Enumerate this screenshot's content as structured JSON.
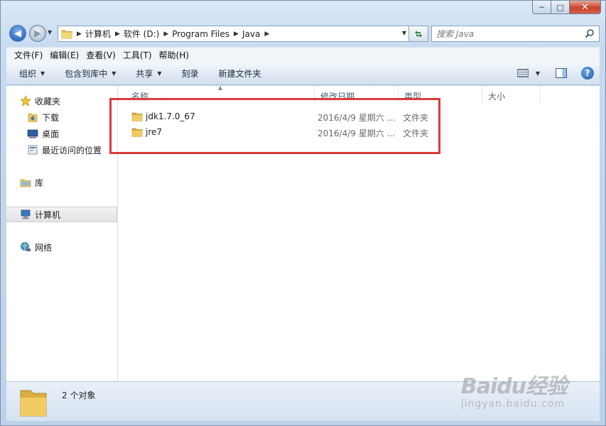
{
  "window": {
    "caption_min": "─",
    "caption_max": "□",
    "caption_close": "✕"
  },
  "address": {
    "crumbs": [
      "计算机",
      "软件 (D:)",
      "Program Files",
      "Java"
    ]
  },
  "search": {
    "placeholder": "搜索 Java"
  },
  "menu": [
    "文件(F)",
    "编辑(E)",
    "查看(V)",
    "工具(T)",
    "帮助(H)"
  ],
  "commands": [
    {
      "label": "组织",
      "dropdown": true
    },
    {
      "label": "包含到库中",
      "dropdown": true
    },
    {
      "label": "共享",
      "dropdown": true
    },
    {
      "label": "刻录",
      "dropdown": false
    },
    {
      "label": "新建文件夹",
      "dropdown": false
    }
  ],
  "help_label": "?",
  "nav": {
    "favorites": "收藏夹",
    "downloads": "下载",
    "desktop": "桌面",
    "recent": "最近访问的位置",
    "libraries": "库",
    "computer": "计算机",
    "network": "网络"
  },
  "columns": {
    "name": "名称",
    "date": "修改日期",
    "type": "类型",
    "size": "大小"
  },
  "files": [
    {
      "name": "jdk1.7.0_67",
      "date": "2016/4/9 星期六 ...",
      "type": "文件夹"
    },
    {
      "name": "jre7",
      "date": "2016/4/9 星期六 ...",
      "type": "文件夹"
    }
  ],
  "status": {
    "count_text": "2 个对象"
  },
  "watermark": {
    "logo": "Baidu经验",
    "url": "jingyan.baidu.com"
  },
  "colors": {
    "highlight": "#dc3b3b",
    "accent": "#2f6ec0"
  }
}
